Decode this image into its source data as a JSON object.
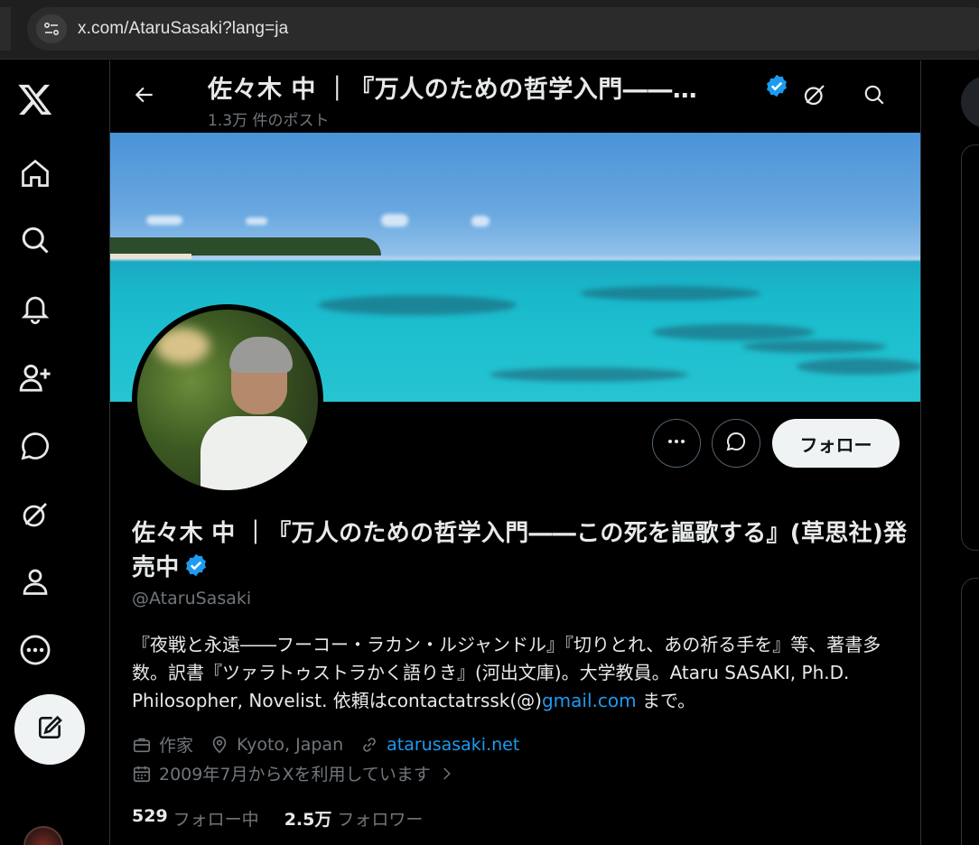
{
  "browser": {
    "url": "x.com/AtaruSasaki?lang=ja"
  },
  "nav": {
    "items": [
      "home-icon",
      "explore-icon",
      "notifications-icon",
      "follow-icon",
      "messages-icon",
      "grok-icon",
      "profile-icon",
      "more-icon"
    ],
    "post_icon": "compose-icon"
  },
  "header": {
    "title": "佐々木 中 ｜『万人のための哲学入門――…",
    "post_count": "1.3万 件のポスト"
  },
  "profile": {
    "display_name": "佐々木 中 ｜『万人のための哲学入門――この死を謳歌する』(草思社)発売中",
    "handle": "@AtaruSasaki",
    "bio_text": "『夜戦と永遠――フーコー・ラカン・ルジャンドル』『切りとれ、あの祈る手を』等、著書多数。訳書『ツァラトゥストラかく語りき』(河出文庫)。大学教員。Ataru SASAKI, Ph.D. Philosopher, Novelist. 依頼はcontactatrssk(@)",
    "bio_link": "gmail.com",
    "bio_tail": " まで。",
    "occupation": "作家",
    "location": "Kyoto, Japan",
    "website": "atarusasaki.net",
    "joined": "2009年7月からXを利用しています",
    "following_count": "529",
    "following_label": "フォロー中",
    "followers_count": "2.5万",
    "followers_label": "フォロワー"
  },
  "actions": {
    "follow_label": "フォロー"
  },
  "colors": {
    "accent": "#1d9bf0",
    "background": "#000000",
    "text": "#e7e9ea",
    "muted": "#71767b"
  }
}
